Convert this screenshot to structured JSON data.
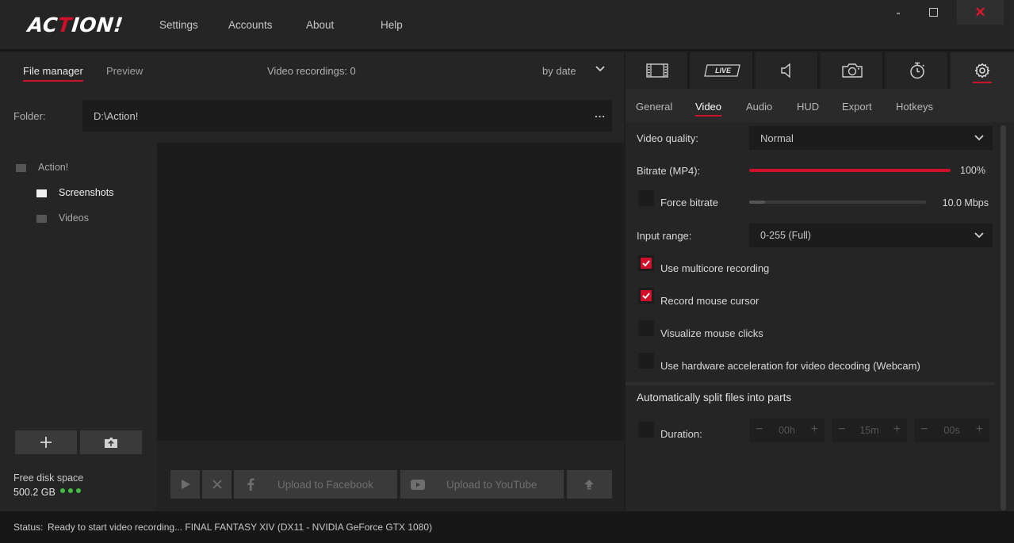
{
  "app": {
    "logo": "ACTION!",
    "menu": [
      "Settings",
      "Accounts",
      "About",
      "Help"
    ],
    "window_controls": {
      "minimize": "-",
      "close": "✕"
    },
    "accent_color": "#d0102a"
  },
  "file_manager": {
    "tabs": [
      "File manager",
      "Preview"
    ],
    "recordings_label": "Video recordings: 0",
    "sort_label": "by date",
    "folder_label": "Folder:",
    "folder_path": "D:\\Action!",
    "folder_browse": "...",
    "tree": [
      "Action!",
      "Screenshots",
      "Videos"
    ],
    "free_space_label": "Free disk space",
    "free_space_value": "500.2 GB",
    "actions": {
      "facebook": "Upload to Facebook",
      "youtube": "Upload to YouTube"
    }
  },
  "settings": {
    "icon_tabs": [
      "film-icon",
      "live-icon",
      "speaker-icon",
      "camera-icon",
      "timer-icon",
      "gear-icon"
    ],
    "live_text": "LIVE",
    "sub_tabs": [
      "General",
      "Video",
      "Audio",
      "HUD",
      "Export",
      "Hotkeys"
    ],
    "video_quality_label": "Video quality:",
    "video_quality_value": "Normal",
    "bitrate_label": "Bitrate (MP4):",
    "bitrate_value": "100%",
    "bitrate_level": 1.0,
    "force_bitrate_label": "Force bitrate",
    "force_bitrate_value": "10.0 Mbps",
    "force_bitrate_level": 0.09,
    "input_range_label": "Input range:",
    "input_range_value": "0-255 (Full)",
    "options": [
      {
        "label": "Use multicore recording",
        "checked": true
      },
      {
        "label": "Record mouse cursor",
        "checked": true
      },
      {
        "label": "Visualize mouse clicks",
        "checked": false
      },
      {
        "label": "Use hardware acceleration for video decoding (Webcam)",
        "checked": false
      }
    ],
    "split_title": "Automatically split files into parts",
    "duration_label": "Duration:",
    "duration": {
      "hours": "00h",
      "minutes": "15m",
      "seconds": "00s"
    }
  },
  "status": {
    "label": "Status:",
    "text": "Ready to start video recording... FINAL FANTASY XIV (DX11 - NVIDIA GeForce GTX 1080)"
  }
}
